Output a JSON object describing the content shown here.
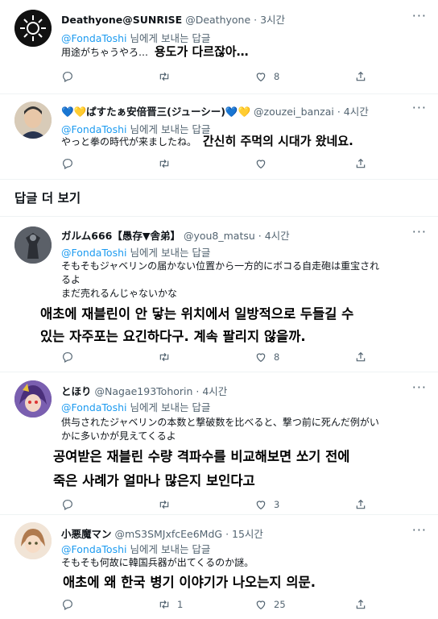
{
  "tweets": [
    {
      "name": "Deathyone@SUNRISE",
      "handle": "@Deathyone",
      "time": "· 3시간",
      "reply_to": "@FondaToshi",
      "reply_suffix": "님에게 보내는 답글",
      "text_jp": "用途がちゃうやろ…",
      "text_ko": "용도가 다르잖아…",
      "replies": "",
      "retweets": "",
      "likes": "8"
    },
    {
      "name": "💙💛ぱすたぁ安倍晋三(ジューシー)💙💛",
      "handle": "@zouzei_banzai",
      "time": "· 4시간",
      "reply_to": "@FondaToshi",
      "reply_suffix": "님에게 보내는 답글",
      "text_jp": "やっと拳の時代が来ましたね。",
      "text_ko": "간신히 주먹의 시대가 왔네요.",
      "replies": "",
      "retweets": "",
      "likes": ""
    },
    {
      "name": "ガルム666【愚存▼舎弟】",
      "handle": "@you8_matsu",
      "time": "· 4시간",
      "reply_to": "@FondaToshi",
      "reply_suffix": "님에게 보내는 답글",
      "text_jp_1": "そもそもジャベリンの届かない位置から一方的にボコる自走砲は重宝され",
      "text_jp_2": "るよ",
      "text_jp_3": "まだ売れるんじゃないかな",
      "text_ko_1": "애초에 재블린이 안 닿는 위치에서 일방적으로 두들길 수",
      "text_ko_2": "있는 자주포는 요긴하다구. 계속 팔리지 않을까.",
      "replies": "",
      "retweets": "",
      "likes": "8"
    },
    {
      "name": "とほり",
      "handle": "@Nagae193Tohorin",
      "time": "· 4시간",
      "reply_to": "@FondaToshi",
      "reply_suffix": "님에게 보내는 답글",
      "text_jp_1": "供与されたジャベリンの本数と撃破数を比べると、撃つ前に死んだ例がい",
      "text_jp_2": "かに多いかが見えてくるよ",
      "text_ko_1": "공여받은 재블린 수량 격파수를 비교해보면 쏘기 전에",
      "text_ko_2": "죽은 사례가 얼마나 많은지 보인다고",
      "replies": "",
      "retweets": "",
      "likes": "3"
    },
    {
      "name": "小悪魔マン",
      "handle": "@mS3SMJxfcEe6MdG",
      "time": "· 15시간",
      "reply_to": "@FondaToshi",
      "reply_suffix": "님에게 보내는 답글",
      "text_jp": "そもそも何故に韓国兵器が出てくるのか謎。",
      "text_ko": "애초에 왜 한국 병기 이야기가 나오는지 의문.",
      "replies": "",
      "retweets": "1",
      "likes": "25"
    }
  ],
  "section_title": "답글 더 보기",
  "more_glyph": "···",
  "icons": [
    "more-icon",
    "reply-icon",
    "retweet-icon",
    "like-icon",
    "share-icon"
  ],
  "colors": {
    "link": "#1d9bf0",
    "muted": "#536471",
    "text": "#0f1419"
  }
}
